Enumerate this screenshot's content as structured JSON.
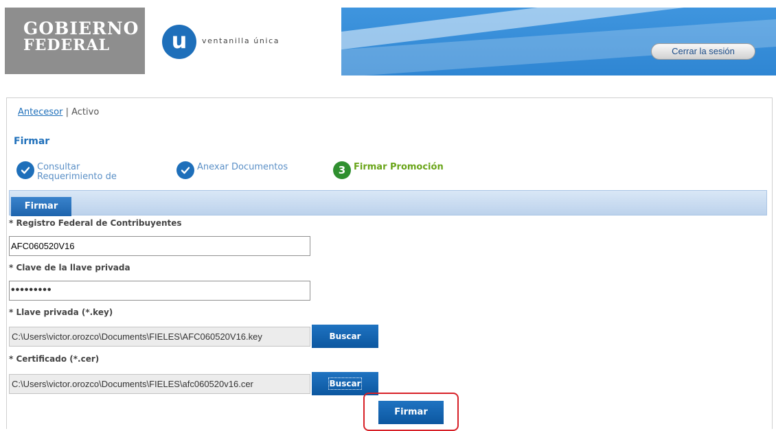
{
  "header": {
    "gov_logo_line1": "GOBIERNO",
    "gov_logo_line2": "FEDERAL",
    "vu_letter": "u",
    "vu_text": "ventanilla única",
    "logout_label": "Cerrar la sesión"
  },
  "breadcrumb": {
    "link": "Antecesor",
    "separator": "|",
    "current": "Activo"
  },
  "page_title": "Firmar",
  "steps": [
    {
      "label": "Consultar Requerimiento de",
      "state": "done",
      "icon": "check-icon"
    },
    {
      "label": "Anexar Documentos",
      "state": "done",
      "icon": "check-icon"
    },
    {
      "number": "3",
      "label": "Firmar Promoción",
      "state": "active"
    }
  ],
  "tab": {
    "label": "Firmar"
  },
  "form": {
    "rfc_label": "* Registro Federal de Contribuyentes",
    "rfc_value": "AFC060520V16",
    "password_label": "* Clave de la llave privada",
    "password_value": "•••••••••",
    "key_label": "* Llave privada (*.key)",
    "key_path": "C:\\Users\\victor.orozco\\Documents\\FIELES\\AFC060520V16.key",
    "cert_label": "* Certificado (*.cer)",
    "cert_path": "C:\\Users\\victor.orozco\\Documents\\FIELES\\afc060520v16.cer",
    "browse_label": "Buscar",
    "submit_label": "Firmar"
  },
  "colors": {
    "primary_blue": "#1e6fba",
    "active_green": "#6aa51a",
    "highlight_red": "#d71f26"
  }
}
